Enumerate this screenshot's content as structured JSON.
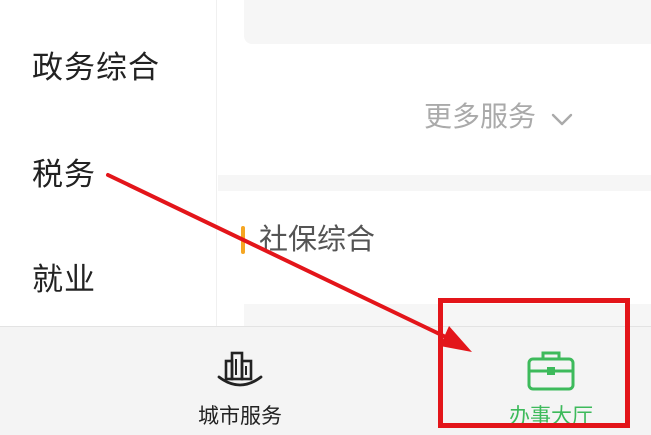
{
  "sidebar": {
    "items": [
      {
        "label": "政务综合"
      },
      {
        "label": "税务"
      },
      {
        "label": "就业"
      }
    ]
  },
  "main": {
    "more_services": "更多服务",
    "section_title": "社保综合"
  },
  "tabbar": {
    "tabs": [
      {
        "label": "城市服务",
        "icon": "city-buildings-icon"
      },
      {
        "label": "办事大厅",
        "icon": "briefcase-icon",
        "active": true
      }
    ]
  },
  "colors": {
    "accent_green": "#3dba5b",
    "annotation_red": "#e3151a",
    "section_marker": "#f5a623"
  }
}
